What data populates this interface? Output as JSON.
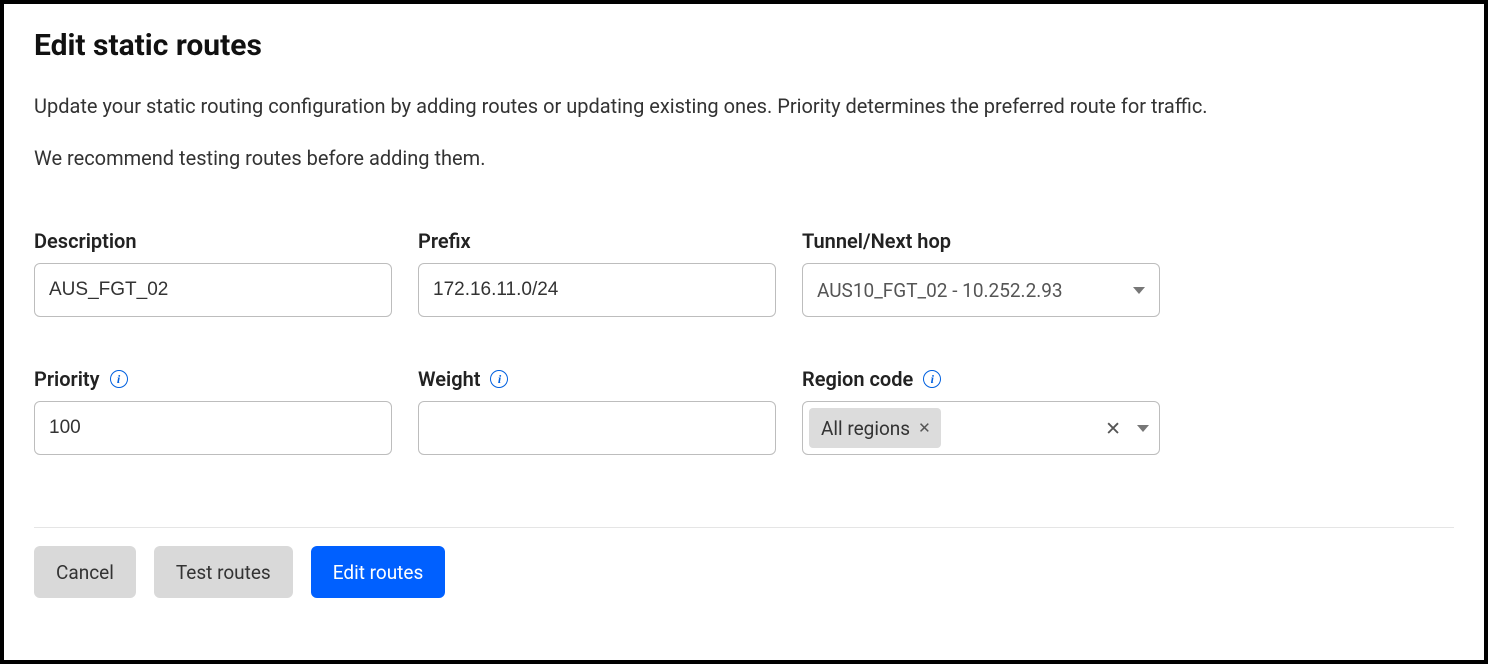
{
  "header": {
    "title": "Edit static routes",
    "intro": "Update your static routing configuration by adding routes or updating existing ones. Priority determines the preferred route for traffic.",
    "recommend": "We recommend testing routes before adding them."
  },
  "fields": {
    "description": {
      "label": "Description",
      "value": "AUS_FGT_02"
    },
    "prefix": {
      "label": "Prefix",
      "value": "172.16.11.0/24"
    },
    "tunnel": {
      "label": "Tunnel/Next hop",
      "value": "AUS10_FGT_02 - 10.252.2.93"
    },
    "priority": {
      "label": "Priority",
      "value": "100"
    },
    "weight": {
      "label": "Weight",
      "value": ""
    },
    "region": {
      "label": "Region code",
      "tag": "All regions"
    }
  },
  "actions": {
    "cancel": "Cancel",
    "test": "Test routes",
    "edit": "Edit routes"
  }
}
